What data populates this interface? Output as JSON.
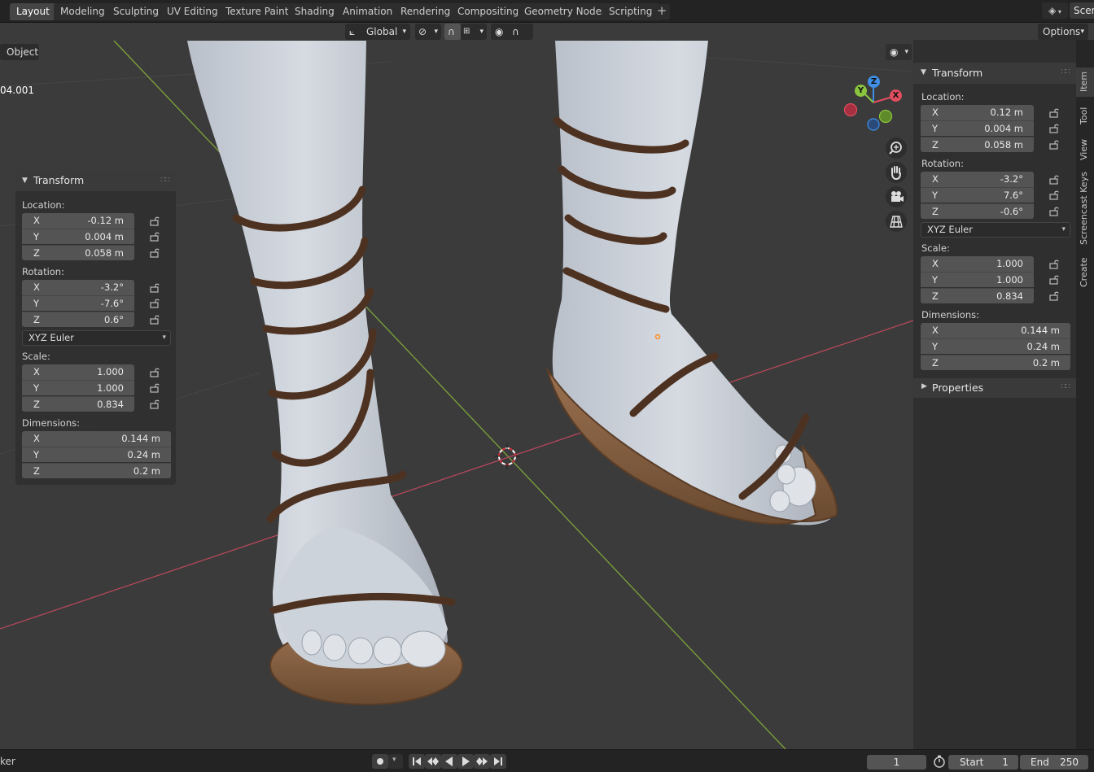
{
  "workspace_tabs": [
    {
      "label": "Layout",
      "active": true
    },
    {
      "label": "Modeling"
    },
    {
      "label": "Sculpting"
    },
    {
      "label": "UV Editing"
    },
    {
      "label": "Texture Paint"
    },
    {
      "label": "Shading"
    },
    {
      "label": "Animation"
    },
    {
      "label": "Rendering"
    },
    {
      "label": "Compositing"
    },
    {
      "label": "Geometry Nodes"
    },
    {
      "label": "Scripting"
    }
  ],
  "add_workspace_label": "+",
  "scene": {
    "name": "Scen"
  },
  "header": {
    "transform_orientation": "Global",
    "options_label": "Options",
    "mode_label": "Object",
    "object_name_overlay": "04.001"
  },
  "left_transform": {
    "title": "Transform",
    "location_label": "Location:",
    "location": [
      {
        "axis": "X",
        "value": "-0.12 m"
      },
      {
        "axis": "Y",
        "value": "0.004 m"
      },
      {
        "axis": "Z",
        "value": "0.058 m"
      }
    ],
    "rotation_label": "Rotation:",
    "rotation": [
      {
        "axis": "X",
        "value": "-3.2°"
      },
      {
        "axis": "Y",
        "value": "-7.6°"
      },
      {
        "axis": "Z",
        "value": "0.6°"
      }
    ],
    "rotation_mode": "XYZ Euler",
    "scale_label": "Scale:",
    "scale": [
      {
        "axis": "X",
        "value": "1.000"
      },
      {
        "axis": "Y",
        "value": "1.000"
      },
      {
        "axis": "Z",
        "value": "0.834"
      }
    ],
    "dimensions_label": "Dimensions:",
    "dimensions": [
      {
        "axis": "X",
        "value": "0.144 m"
      },
      {
        "axis": "Y",
        "value": "0.24 m"
      },
      {
        "axis": "Z",
        "value": "0.2 m"
      }
    ]
  },
  "right_transform": {
    "title": "Transform",
    "location_label": "Location:",
    "location": [
      {
        "axis": "X",
        "value": "0.12 m"
      },
      {
        "axis": "Y",
        "value": "0.004 m"
      },
      {
        "axis": "Z",
        "value": "0.058 m"
      }
    ],
    "rotation_label": "Rotation:",
    "rotation": [
      {
        "axis": "X",
        "value": "-3.2°"
      },
      {
        "axis": "Y",
        "value": "7.6°"
      },
      {
        "axis": "Z",
        "value": "-0.6°"
      }
    ],
    "rotation_mode": "XYZ Euler",
    "scale_label": "Scale:",
    "scale": [
      {
        "axis": "X",
        "value": "1.000"
      },
      {
        "axis": "Y",
        "value": "1.000"
      },
      {
        "axis": "Z",
        "value": "0.834"
      }
    ],
    "dimensions_label": "Dimensions:",
    "dimensions": [
      {
        "axis": "X",
        "value": "0.144 m"
      },
      {
        "axis": "Y",
        "value": "0.24 m"
      },
      {
        "axis": "Z",
        "value": "0.2 m"
      }
    ],
    "properties_label": "Properties"
  },
  "sidebar_tabs": [
    {
      "label": "Item",
      "active": true
    },
    {
      "label": "Tool"
    },
    {
      "label": "View"
    },
    {
      "label": "Screencast Keys"
    },
    {
      "label": "Create"
    }
  ],
  "gizmo": {
    "x_label": "X",
    "y_label": "Y",
    "z_label": "Z"
  },
  "timeline": {
    "left_label": "ker",
    "current_frame": "1",
    "start_label": "Start",
    "start_value": "1",
    "end_label": "End",
    "end_value": "250"
  },
  "colors": {
    "x_axis": "#e04e5f",
    "y_axis": "#8bc43f",
    "z_axis": "#3f8fe6",
    "accent": "#4772b3",
    "skin": "#c9cfd8",
    "strap": "#5a3a25",
    "sole": "#8a6141"
  }
}
